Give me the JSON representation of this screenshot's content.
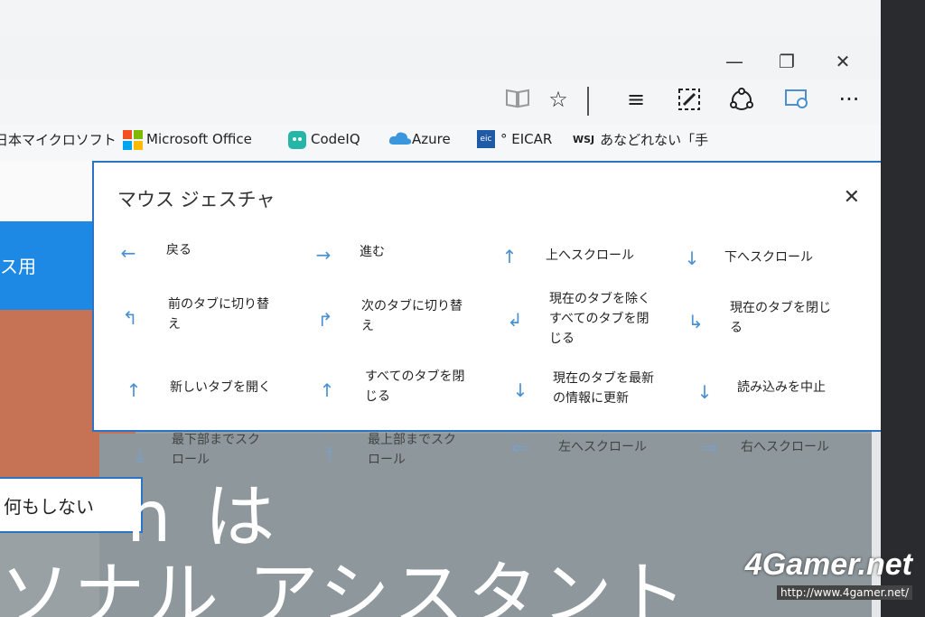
{
  "window": {
    "controls": {
      "minimize": "—",
      "restore": "❐",
      "close": "✕"
    }
  },
  "toolbar": {
    "icons": [
      "reading-view-icon",
      "favorite-star-icon",
      "hub-icon",
      "web-note-icon",
      "share-icon",
      "feedback-icon",
      "more-icon"
    ],
    "more_label": "···"
  },
  "favorites": {
    "items": [
      {
        "label": "日本マイクロソフト",
        "icon": "microsoft-logo-icon"
      },
      {
        "label": "Microsoft Office",
        "icon": "office-logo-icon"
      },
      {
        "label": "CodeIQ",
        "icon": "codeiq-icon"
      },
      {
        "label": "Azure",
        "icon": "azure-cloud-icon"
      },
      {
        "label": "° EICAR",
        "icon": "eicar-icon"
      },
      {
        "label": "あなどれない「手",
        "icon": "wsj-icon"
      }
    ],
    "wsj_text": "WSJ",
    "eic_text": "eic"
  },
  "page": {
    "blue_panel_text": "ス用",
    "input_value": "何もしない",
    "hero_fragment": "n は",
    "hero_line": "ソナル アシスタント",
    "hidden_labels": [
      "最下部までスク\nロール",
      "最上部までスク\nロール",
      "左へスクロール",
      "右へスクロール"
    ]
  },
  "gesture_panel": {
    "title": "マウス ジェスチャ",
    "close": "✕",
    "gestures": [
      {
        "arrow": "←",
        "label": "戻る"
      },
      {
        "arrow": "→",
        "label": "進む"
      },
      {
        "arrow": "↑",
        "label": "上へスクロール"
      },
      {
        "arrow": "↓",
        "label": "下へスクロール"
      },
      {
        "arrow": "↰",
        "label": "前のタブに切り替\nえ"
      },
      {
        "arrow": "↱",
        "label": "次のタブに切り替\nえ"
      },
      {
        "arrow": "↲",
        "label": "現在のタブを除く\nすべてのタブを閉\nじる"
      },
      {
        "arrow": "↳",
        "label": "現在のタブを閉じ\nる"
      },
      {
        "arrow": "↑",
        "label": "新しいタブを開く"
      },
      {
        "arrow": "↑",
        "label": "すべてのタブを閉\nじる"
      },
      {
        "arrow": "↓",
        "label": "現在のタブを最新\nの情報に更新"
      },
      {
        "arrow": "↓",
        "label": "読み込みを中止"
      }
    ]
  },
  "watermark": {
    "logo": "4Gamer.net",
    "url": "http://www.4gamer.net/"
  },
  "colors": {
    "accent": "#2b73c7",
    "arrow": "#4a8fd0",
    "blue_panel": "#1e88e5"
  }
}
